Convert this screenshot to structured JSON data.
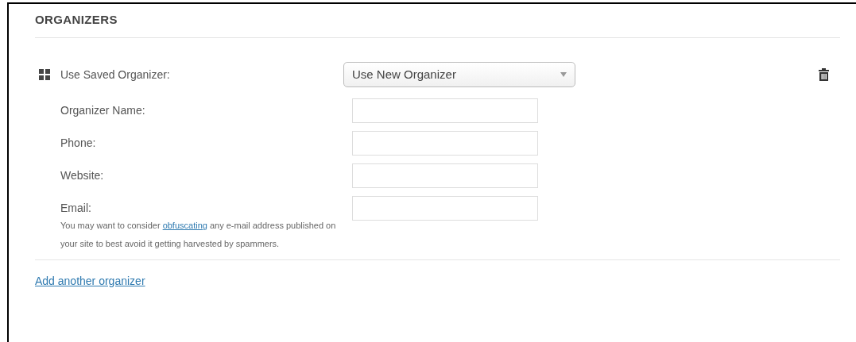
{
  "section": {
    "title": "ORGANIZERS"
  },
  "organizer": {
    "select": {
      "label": "Use Saved Organizer:",
      "value": "Use New Organizer"
    },
    "fields": [
      {
        "label": "Organizer Name:"
      },
      {
        "label": "Phone:"
      },
      {
        "label": "Website:"
      },
      {
        "label": "Email:",
        "help": {
          "before": "You may want to consider ",
          "link": "obfuscating",
          "after": " any e-mail address published on your site to best avoid it getting harvested by spammers."
        }
      }
    ]
  },
  "add_link": "Add another organizer"
}
